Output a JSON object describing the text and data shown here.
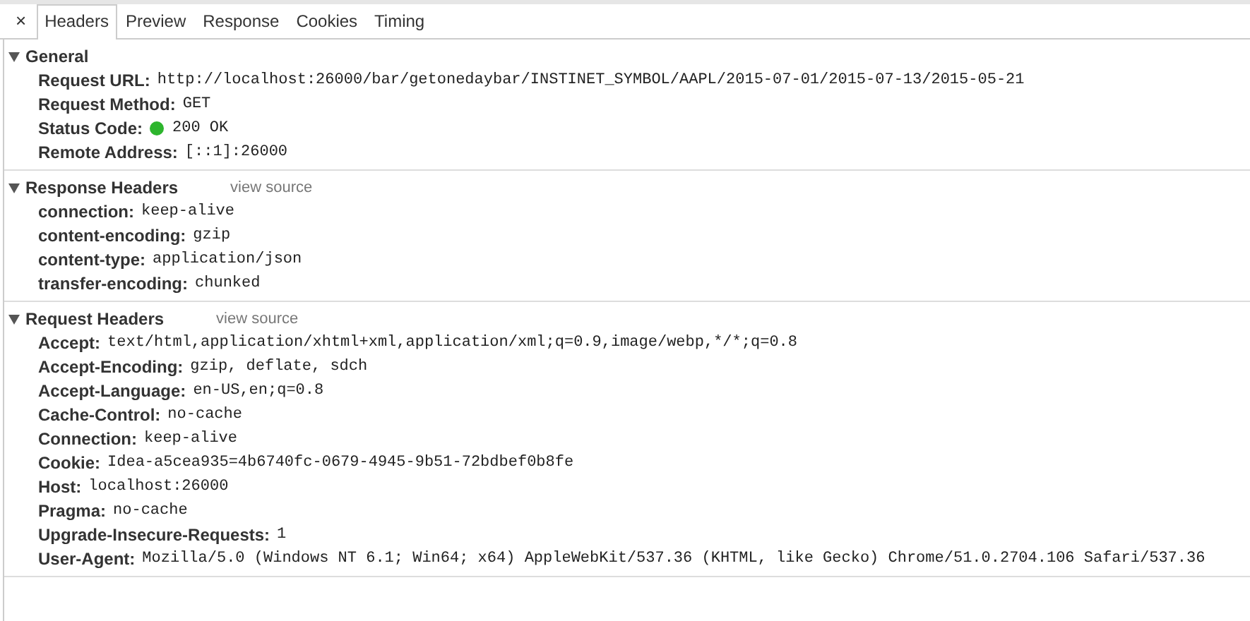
{
  "close_button": "×",
  "tabs": [
    {
      "label": "Headers",
      "selected": true
    },
    {
      "label": "Preview",
      "selected": false
    },
    {
      "label": "Response",
      "selected": false
    },
    {
      "label": "Cookies",
      "selected": false
    },
    {
      "label": "Timing",
      "selected": false
    }
  ],
  "sections": [
    {
      "title": "General",
      "expanded": true,
      "rows": [
        {
          "kind": "plain",
          "name": "Request URL:",
          "value": "http://localhost:26000/bar/getonedaybar/INSTINET_SYMBOL/AAPL/2015-07-01/2015-07-13/2015-05-21"
        },
        {
          "kind": "plain",
          "name": "Request Method:",
          "value": "GET"
        },
        {
          "kind": "status",
          "name": "Status Code:",
          "value": "200 OK"
        },
        {
          "kind": "plain",
          "name": "Remote Address:",
          "value": "[::1]:26000"
        }
      ]
    },
    {
      "title": "Response Headers",
      "expanded": true,
      "link": "view source",
      "rows": [
        {
          "kind": "plain",
          "name": "connection:",
          "value": "keep-alive"
        },
        {
          "kind": "plain",
          "name": "content-encoding:",
          "value": "gzip"
        },
        {
          "kind": "plain",
          "name": "content-type:",
          "value": "application/json"
        },
        {
          "kind": "plain",
          "name": "transfer-encoding:",
          "value": "chunked"
        }
      ]
    },
    {
      "title": "Request Headers",
      "expanded": true,
      "link": "view source",
      "rows": [
        {
          "kind": "plain",
          "name": "Accept:",
          "value": "text/html,application/xhtml+xml,application/xml;q=0.9,image/webp,*/*;q=0.8"
        },
        {
          "kind": "plain",
          "name": "Accept-Encoding:",
          "value": "gzip, deflate, sdch"
        },
        {
          "kind": "plain",
          "name": "Accept-Language:",
          "value": "en-US,en;q=0.8"
        },
        {
          "kind": "plain",
          "name": "Cache-Control:",
          "value": "no-cache"
        },
        {
          "kind": "plain",
          "name": "Connection:",
          "value": "keep-alive"
        },
        {
          "kind": "plain",
          "name": "Cookie:",
          "value": "Idea-a5cea935=4b6740fc-0679-4945-9b51-72bdbef0b8fe"
        },
        {
          "kind": "plain",
          "name": "Host:",
          "value": "localhost:26000"
        },
        {
          "kind": "plain",
          "name": "Pragma:",
          "value": "no-cache"
        },
        {
          "kind": "plain",
          "name": "Upgrade-Insecure-Requests:",
          "value": "1"
        },
        {
          "kind": "plain",
          "name": "User-Agent:",
          "value": "Mozilla/5.0 (Windows NT 6.1; Win64; x64) AppleWebKit/537.36 (KHTML, like Gecko) Chrome/51.0.2704.106 Safari/537.36"
        }
      ]
    }
  ]
}
